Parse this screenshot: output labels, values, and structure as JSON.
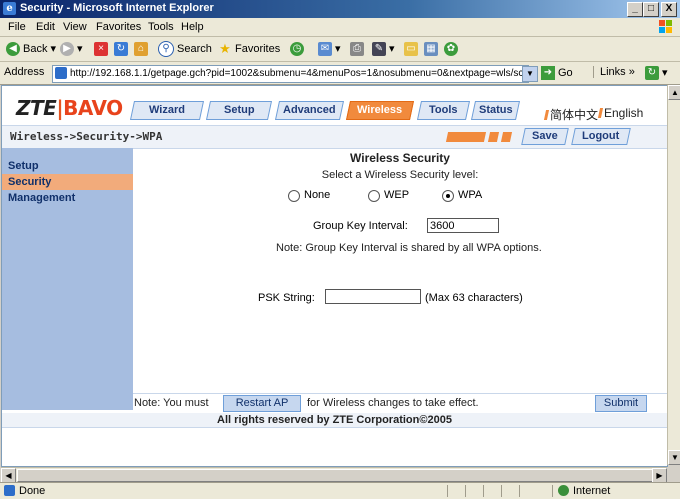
{
  "window": {
    "title": "Security - Microsoft Internet Explorer",
    "minimize": "_",
    "maximize": "□",
    "close": "X"
  },
  "menu": [
    "File",
    "Edit",
    "View",
    "Favorites",
    "Tools",
    "Help"
  ],
  "toolbar": {
    "back": "Back",
    "search": "Search",
    "favorites": "Favorites"
  },
  "address": {
    "label": "Address",
    "url": "http://192.168.1.1/getpage.gch?pid=1002&submenu=4&menuPos=1&nosubmenu=0&nextpage=wls/scy_",
    "go": "Go",
    "links": "Links"
  },
  "page": {
    "logo": {
      "zte": "ZTE",
      "bar": "|",
      "bavo": "BAVO"
    },
    "nav": [
      "Wizard",
      "Setup",
      "Advanced",
      "Wireless",
      "Tools",
      "Status"
    ],
    "active_nav": "Wireless",
    "lang": {
      "chinese": "简体中文",
      "english": "English"
    },
    "breadcrumb": "Wireless->Security->WPA",
    "save_label": "Save",
    "logout_label": "Logout",
    "sidebar": [
      {
        "label": "Setup",
        "active": false
      },
      {
        "label": "Security",
        "active": true
      },
      {
        "label": "Management",
        "active": false
      }
    ],
    "section_title": "Wireless Security",
    "level_prompt": "Select a Wireless Security level:",
    "levels": [
      {
        "label": "None",
        "selected": false
      },
      {
        "label": "WEP",
        "selected": false
      },
      {
        "label": "WPA",
        "selected": true
      }
    ],
    "group_key_label": "Group Key Interval:",
    "group_key_value": "3600",
    "note": "Note: Group Key Interval is shared by all WPA options.",
    "psk_label": "PSK String:",
    "psk_value": "",
    "psk_hint": "(Max 63 characters)",
    "restart_note_pre": "Note: You must",
    "restart_label": "Restart AP",
    "restart_note_post": "for Wireless changes to take effect.",
    "submit_label": "Submit",
    "footer": "All rights reserved by ZTE Corporation©2005"
  },
  "status": {
    "left": "Done",
    "zone": "Internet"
  },
  "colors": {
    "accent_orange": "#f18a3d",
    "nav_blue": "#1f3c7a",
    "sidebar_bg": "#a6bde0"
  }
}
